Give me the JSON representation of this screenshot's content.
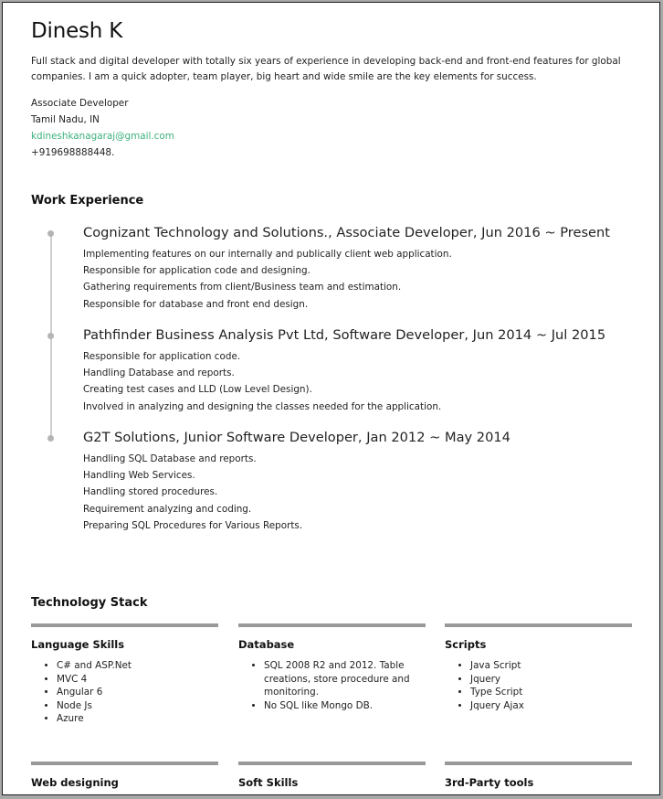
{
  "header": {
    "name": "Dinesh K",
    "summary": "Full stack and digital developer with totally six years of experience in developing back-end and front-end features for global companies. I am a quick adopter, team player, big heart and wide smile are the key elements for success.",
    "title": "Associate Developer",
    "location": "Tamil Nadu, IN",
    "email": "kdineshkanagaraj@gmail.com",
    "phone": "+919698888448."
  },
  "colors": {
    "accent_link": "#3db27b",
    "bar": "#999999",
    "timeline": "#cfcfcf"
  },
  "work": {
    "title": "Work Experience",
    "jobs": [
      {
        "heading": "Cognizant Technology and Solutions., Associate Developer, Jun 2016 ~ Present",
        "items": [
          "Implementing features on our internally and publically client web application.",
          "Responsible for application code and designing.",
          "Gathering requirements from client/Business team and estimation.",
          "Responsible for database and front end design."
        ]
      },
      {
        "heading": "Pathfinder Business Analysis Pvt Ltd, Software Developer, Jun 2014 ~ Jul 2015",
        "items": [
          "Responsible for application code.",
          "Handling Database and reports.",
          "Creating test cases and LLD (Low Level Design).",
          "Involved in analyzing and designing the classes needed for the application."
        ]
      },
      {
        "heading": "G2T Solutions, Junior Software Developer, Jan 2012 ~ May 2014",
        "items": [
          "Handling SQL Database and reports.",
          "Handling Web Services.",
          "Handling stored procedures.",
          "Requirement analyzing and coding.",
          "Preparing SQL Procedures for Various Reports."
        ]
      }
    ]
  },
  "stack": {
    "title": "Technology Stack",
    "groups": [
      {
        "title": "Language Skills",
        "items": [
          "C# and ASP.Net",
          "MVC 4",
          "Angular 6",
          "Node Js",
          "Azure"
        ]
      },
      {
        "title": "Database",
        "items": [
          "SQL 2008 R2 and 2012. Table creations, store procedure and monitoring.",
          "No SQL like Mongo DB."
        ]
      },
      {
        "title": "Scripts",
        "items": [
          "Java Script",
          "Jquery",
          "Type Script",
          "Jquery Ajax"
        ]
      },
      {
        "title": "Web designing",
        "items": []
      },
      {
        "title": "Soft Skills",
        "items": []
      },
      {
        "title": "3rd-Party tools",
        "items": []
      }
    ]
  }
}
